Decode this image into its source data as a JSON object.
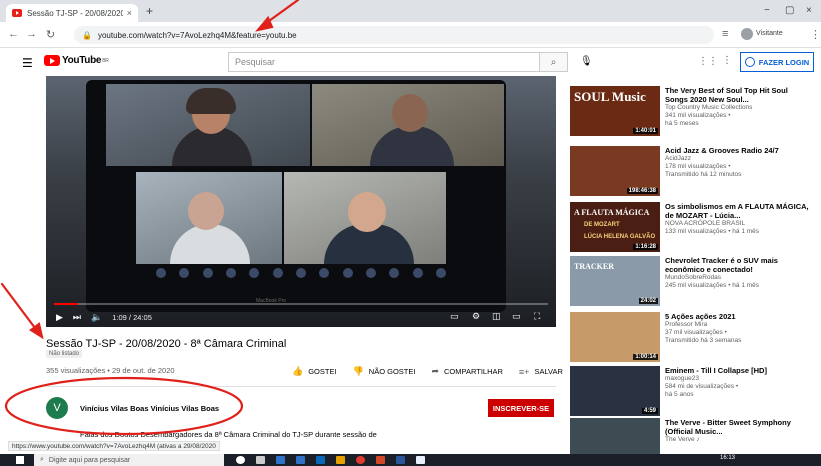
{
  "browser": {
    "tab_title": "Sessão TJ-SP - 20/08/2020 - 8ª C",
    "tab_close": "×",
    "new_tab": "+",
    "url": "youtube.com/watch?v=7AvoLezhq4M&feature=youtu.be",
    "profile": "Visitante",
    "win_min": "−",
    "win_max": "▢",
    "win_close": "×"
  },
  "youtube": {
    "logo": "YouTube",
    "logo_suffix": "BR",
    "search_placeholder": "Pesquisar",
    "login_label": "FAZER LOGIN"
  },
  "video": {
    "time": "1:09 / 24:05",
    "progress": 0.048,
    "watermark": "MacBook Pro",
    "title": "Sessão TJ-SP - 20/08/2020 - 8ª Câmara Criminal",
    "unlisted": "Não listado",
    "views": "355 visualizações • 29 de out. de 2020",
    "like": "GOSTEI",
    "dislike": "NÃO GOSTEI",
    "share": "COMPARTILHAR",
    "save": "SALVAR",
    "more": "…",
    "channel_initial": "V",
    "channel_name": "Vinícius Vilas Boas Vinícius Vilas Boas",
    "subscribe": "INSCREVER-SE",
    "description": "Falas dos Doutos Desembargadores da 8ª Câmara Criminal do TJ-SP durante sessão de",
    "status_url": "https://www.youtube.com/watch?v=7AvoLezhq4M",
    "status_suffix": " (ativas a 29/08/2020"
  },
  "related": [
    {
      "title": "The Very Best of Soul Top Hit Soul Songs 2020 New Soul...",
      "channel": "Top Country Music Collections",
      "views": "341 mil visualizações •",
      "age": "há 5 meses",
      "duration": "1:40:01",
      "thumb_text": "SOUL Music",
      "thumb_color": "#6b2a14"
    },
    {
      "title": "Acid Jazz & Grooves Radio 24/7",
      "channel": "AcidJazz",
      "views": "178 mil visualizações •",
      "age": "Transmitido há 12 minutos",
      "duration": "198:46:38",
      "thumb_text": "",
      "thumb_color": "#7a3a22"
    },
    {
      "title": "Os simbolismos em A FLAUTA MÁGICA, de MOZART - Lúcia...",
      "channel": "NOVA ACRÓPOLE BRASIL",
      "views": "133 mil visualizações • há 1 mês",
      "age": "",
      "duration": "1:16:28",
      "thumb_text": "A FLAUTA MÁGICA",
      "thumb_sub": "DE MOZART",
      "thumb_sub2": "LÚCIA HELENA GALVÃO",
      "thumb_color": "#4a1e12"
    },
    {
      "title": "Chevrolet Tracker é o SUV mais econômico e conectado!",
      "channel": "MundoSobreRodas",
      "views": "245 mil visualizações • há 1 mês",
      "age": "",
      "duration": "24:02",
      "thumb_text": "TRACKER",
      "thumb_color": "#8a9aa8"
    },
    {
      "title": "5 Ações ações 2021",
      "channel": "Professor Mira",
      "views": "37 mil visualizações •",
      "age": "Transmitido há 3 semanas",
      "duration": "1:00:14",
      "thumb_text": "",
      "thumb_color": "#c79a6a"
    },
    {
      "title": "Eminem - Till I Collapse [HD]",
      "channel": "maxogue23",
      "views": "584 mi de visualizações •",
      "age": "há 5 anos",
      "duration": "4:59",
      "thumb_text": "",
      "thumb_color": "#2a3140"
    },
    {
      "title": "The Verve - Bitter Sweet Symphony (Official Music...",
      "channel": "The Verve ♪",
      "views": "",
      "age": "",
      "duration": "",
      "thumb_text": "",
      "thumb_color": "#3d4b52"
    }
  ],
  "taskbar": {
    "search_placeholder": "Digite aqui para pesquisar",
    "clock": "16:13"
  },
  "colors": {
    "accent_red": "#ff0000",
    "annotation_red": "#e0201b",
    "login_blue": "#065fd4",
    "subscribe_red": "#cc0000",
    "channel_avatar": "#1e7c4c"
  }
}
